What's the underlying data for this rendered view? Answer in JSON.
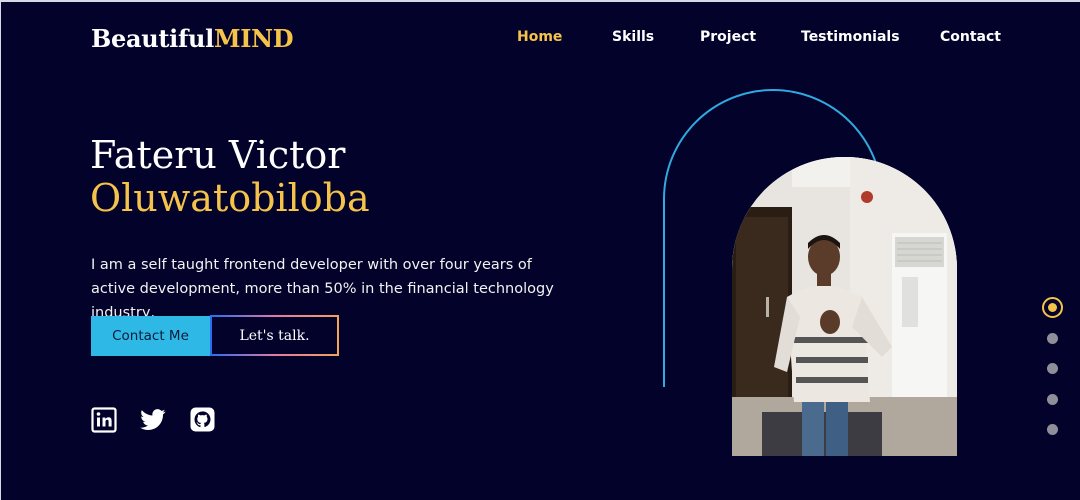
{
  "brand": {
    "part1": "Beautiful",
    "part2": "MIND"
  },
  "nav": {
    "items": [
      "Home",
      "Skills",
      "Project",
      "Testimonials",
      "Contact"
    ],
    "active": "Home"
  },
  "hero": {
    "first_name": "Fateru Victor",
    "last_name": "Oluwatobiloba",
    "bio": "I am a self taught frontend developer with over four years of active development, more than 50% in the financial technology industry,",
    "contact_button": "Contact Me",
    "talk_button": "Let's talk."
  },
  "social": [
    {
      "icon": "linkedin-icon"
    },
    {
      "icon": "twitter-icon"
    },
    {
      "icon": "github-icon"
    }
  ],
  "pager": {
    "count": 5,
    "active_index": 0
  },
  "colors": {
    "background": "#02022a",
    "accent": "#f6c34a",
    "button": "#2eb8e6",
    "arch": "#2fa9e0"
  }
}
